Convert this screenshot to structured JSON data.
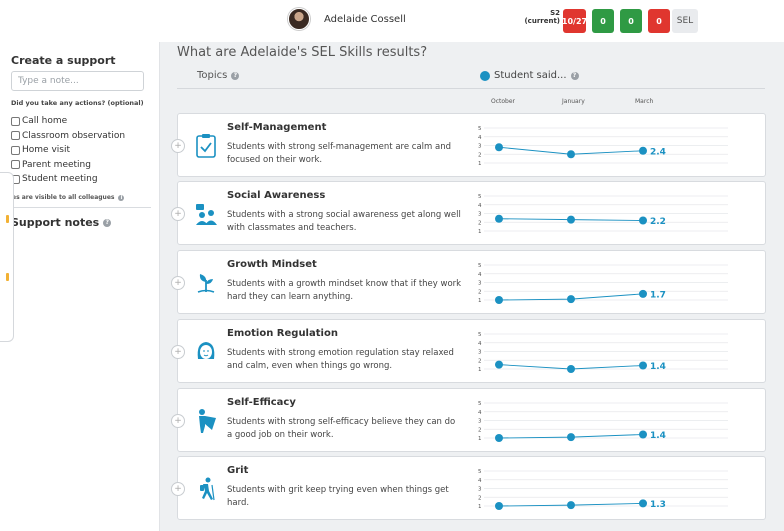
{
  "header": {
    "student_name": "Adelaide Cossell",
    "semester_label": "S2",
    "semester_sub": "(current)",
    "badges": [
      {
        "label": "10/27",
        "color": "#e0362f"
      },
      {
        "label": "0",
        "color": "#2f9a44"
      },
      {
        "label": "0",
        "color": "#2f9a44"
      },
      {
        "label": "0",
        "color": "#e0362f"
      }
    ],
    "sel_tab": "SEL"
  },
  "sidebar": {
    "title": "Create a support",
    "note_placeholder": "Type a note...",
    "actions_question": "Did you take any actions? (optional)",
    "actions": [
      "Call home",
      "Classroom observation",
      "Home visit",
      "Parent meeting",
      "Student meeting"
    ],
    "visibility_note": "Notes are visible to all colleagues",
    "support_notes_title": "Support notes"
  },
  "main": {
    "question": "What are Adelaide's SEL Skills results?",
    "topics_label": "Topics",
    "legend_label": "Student said...",
    "accent_color": "#1b91c2",
    "months": [
      "October",
      "January",
      "March"
    ]
  },
  "chart_data": {
    "type": "line",
    "x": [
      "October",
      "January",
      "March"
    ],
    "ylim": [
      1,
      5
    ],
    "yticks": [
      1,
      2,
      3,
      4,
      5
    ],
    "series": [
      {
        "name": "Self-Management",
        "values": [
          2.8,
          2.0,
          2.4
        ],
        "label": "2.4"
      },
      {
        "name": "Social Awareness",
        "values": [
          2.4,
          2.3,
          2.2
        ],
        "label": "2.2"
      },
      {
        "name": "Growth Mindset",
        "values": [
          1.0,
          1.1,
          1.7
        ],
        "label": "1.7"
      },
      {
        "name": "Emotion Regulation",
        "values": [
          1.5,
          1.0,
          1.4
        ],
        "label": "1.4"
      },
      {
        "name": "Self-Efficacy",
        "values": [
          1.0,
          1.1,
          1.4
        ],
        "label": "1.4"
      },
      {
        "name": "Grit",
        "values": [
          1.0,
          1.1,
          1.3
        ],
        "label": "1.3"
      }
    ]
  },
  "skills": [
    {
      "title": "Self-Management",
      "description": "Students with strong self-management are calm and focused on their work.",
      "icon": "clipboard-check-icon"
    },
    {
      "title": "Social Awareness",
      "description": "Students with a strong social awareness get along well with classmates and teachers.",
      "icon": "people-chat-icon"
    },
    {
      "title": "Growth Mindset",
      "description": "Students with a growth mindset know that if they work hard they can learn anything.",
      "icon": "sprout-icon"
    },
    {
      "title": "Emotion Regulation",
      "description": "Students with strong emotion regulation stay relaxed and calm, even when things go wrong.",
      "icon": "calm-face-icon"
    },
    {
      "title": "Self-Efficacy",
      "description": "Students with strong self-efficacy believe they can do a good job on their work.",
      "icon": "superhero-icon"
    },
    {
      "title": "Grit",
      "description": "Students with grit keep trying even when things get hard.",
      "icon": "hiker-icon"
    }
  ]
}
